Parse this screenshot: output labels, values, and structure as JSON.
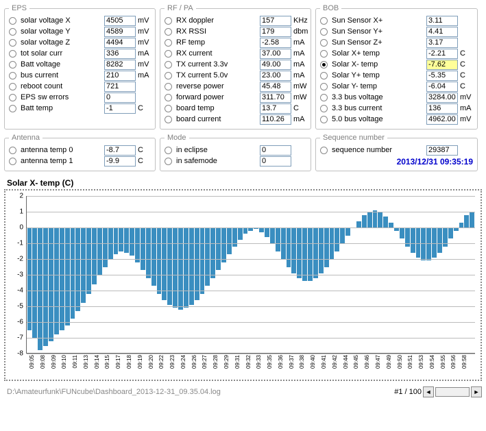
{
  "eps": {
    "legend": "EPS",
    "rows": [
      {
        "label": "solar voltage X",
        "value": "4505",
        "unit": "mV",
        "sel": false
      },
      {
        "label": "solar voltage Y",
        "value": "4589",
        "unit": "mV",
        "sel": false
      },
      {
        "label": "solar voltage Z",
        "value": "4494",
        "unit": "mV",
        "sel": false
      },
      {
        "label": "tot solar curr",
        "value": "336",
        "unit": "mA",
        "sel": false
      },
      {
        "label": "Batt voltage",
        "value": "8282",
        "unit": "mV",
        "sel": false
      },
      {
        "label": "bus current",
        "value": "210",
        "unit": "mA",
        "sel": false
      },
      {
        "label": "reboot count",
        "value": "721",
        "unit": "",
        "sel": false
      },
      {
        "label": "EPS sw errors",
        "value": "0",
        "unit": "",
        "sel": false
      },
      {
        "label": "Batt temp",
        "value": "-1",
        "unit": "C",
        "sel": false
      }
    ]
  },
  "rfpa": {
    "legend": "RF / PA",
    "rows": [
      {
        "label": "RX doppler",
        "value": "157",
        "unit": "KHz",
        "sel": false
      },
      {
        "label": "RX RSSI",
        "value": "179",
        "unit": "dbm",
        "sel": false
      },
      {
        "label": "RF temp",
        "value": "-2.58",
        "unit": "mA",
        "sel": false
      },
      {
        "label": "RX current",
        "value": "37.00",
        "unit": "mA",
        "sel": false
      },
      {
        "label": "TX current 3.3v",
        "value": "49.00",
        "unit": "mA",
        "sel": false
      },
      {
        "label": "TX current 5.0v",
        "value": "23.00",
        "unit": "mA",
        "sel": false
      },
      {
        "label": "reverse power",
        "value": "45.48",
        "unit": "mW",
        "sel": false
      },
      {
        "label": "forward power",
        "value": "311.70",
        "unit": "mW",
        "sel": false
      },
      {
        "label": "board temp",
        "value": "13.7",
        "unit": "C",
        "sel": false
      },
      {
        "label": "board current",
        "value": "110.26",
        "unit": "mA",
        "sel": false
      }
    ]
  },
  "bob": {
    "legend": "BOB",
    "rows": [
      {
        "label": "Sun Sensor X+",
        "value": "3.11",
        "unit": "",
        "sel": false
      },
      {
        "label": "Sun Sensor Y+",
        "value": "4.41",
        "unit": "",
        "sel": false
      },
      {
        "label": "Sun Sensor Z+",
        "value": "3.17",
        "unit": "",
        "sel": false
      },
      {
        "label": "Solar X+ temp",
        "value": "-2.21",
        "unit": "C",
        "sel": false
      },
      {
        "label": "Solar X- temp",
        "value": "-7.62",
        "unit": "C",
        "sel": true,
        "hl": true
      },
      {
        "label": "Solar Y+ temp",
        "value": "-5.35",
        "unit": "C",
        "sel": false
      },
      {
        "label": "Solar Y- temp",
        "value": "-6.04",
        "unit": "C",
        "sel": false
      },
      {
        "label": "3.3 bus voltage",
        "value": "3284.00",
        "unit": "mV",
        "sel": false
      },
      {
        "label": "3.3 bus current",
        "value": "136",
        "unit": "mA",
        "sel": false
      },
      {
        "label": "5.0 bus voltage",
        "value": "4962.00",
        "unit": "mV",
        "sel": false
      }
    ]
  },
  "antenna": {
    "legend": "Antenna",
    "rows": [
      {
        "label": "antenna temp 0",
        "value": "-8.7",
        "unit": "C",
        "sel": false
      },
      {
        "label": "antenna temp 1",
        "value": "-9.9",
        "unit": "C",
        "sel": false
      }
    ]
  },
  "mode": {
    "legend": "Mode",
    "rows": [
      {
        "label": "in eclipse",
        "value": "0",
        "unit": "",
        "sel": false
      },
      {
        "label": "in safemode",
        "value": "0",
        "unit": "",
        "sel": false
      }
    ]
  },
  "seq": {
    "legend": "Sequence number",
    "rows": [
      {
        "label": "sequence number",
        "value": "29387",
        "unit": "",
        "sel": false
      }
    ],
    "timestamp": "2013/12/31 09:35:19"
  },
  "chart_data": {
    "type": "bar",
    "title": "Solar X- temp     (C)",
    "ylim": [
      -8,
      2
    ],
    "yticks": [
      2,
      1,
      0,
      -1,
      -2,
      -3,
      -4,
      -5,
      -6,
      -7,
      -8
    ],
    "categories": [
      "09:05",
      "",
      "09:08",
      "",
      "09:09",
      "",
      "09:10",
      "",
      "09:11",
      "",
      "09:13",
      "",
      "09:14",
      "",
      "09:15",
      "",
      "09:17",
      "",
      "09:18",
      "",
      "09:19",
      "",
      "09:20",
      "",
      "09:22",
      "",
      "09:23",
      "",
      "09:24",
      "",
      "09:26",
      "",
      "09:27",
      "",
      "09:28",
      "",
      "09:29",
      "",
      "09:31",
      "",
      "09:32",
      "",
      "09:33",
      "",
      "09:35",
      "",
      "09:36",
      "",
      "09:37",
      "",
      "09:38",
      "",
      "09:40",
      "",
      "09:41",
      "",
      "09:42",
      "",
      "09:44",
      "",
      "09:45",
      "",
      "09:46",
      "",
      "09:47",
      "",
      "09:49",
      "",
      "09:50",
      "",
      "09:51",
      "",
      "09:53",
      "",
      "09:54",
      "",
      "09:55",
      "",
      "09:56",
      "",
      "09:58",
      "",
      ""
    ],
    "values": [
      -6.5,
      -7.0,
      -7.8,
      -7.5,
      -7.2,
      -6.8,
      -6.5,
      -6.2,
      -5.8,
      -5.3,
      -4.8,
      -4.2,
      -3.6,
      -3.0,
      -2.5,
      -2.0,
      -1.7,
      -1.5,
      -1.6,
      -1.8,
      -2.2,
      -2.7,
      -3.2,
      -3.7,
      -4.2,
      -4.6,
      -4.9,
      -5.1,
      -5.2,
      -5.1,
      -4.9,
      -4.6,
      -4.2,
      -3.7,
      -3.2,
      -2.7,
      -2.2,
      -1.7,
      -1.2,
      -0.8,
      -0.4,
      -0.2,
      -0.1,
      -0.3,
      -0.6,
      -1.0,
      -1.5,
      -2.0,
      -2.5,
      -2.9,
      -3.2,
      -3.4,
      -3.4,
      -3.2,
      -2.9,
      -2.5,
      -2.0,
      -1.5,
      -1.0,
      -0.5,
      0.0,
      0.4,
      0.8,
      1.0,
      1.1,
      1.0,
      0.7,
      0.3,
      -0.2,
      -0.7,
      -1.2,
      -1.6,
      -1.9,
      -2.1,
      -2.1,
      -1.9,
      -1.6,
      -1.2,
      -0.7,
      -0.2,
      0.3,
      0.8,
      1.0
    ]
  },
  "footer": {
    "path": "D:\\Amateurfunk\\FUNcube\\Dashboard_2013-12-31_09.35.04.log",
    "page": "#1 / 100"
  }
}
